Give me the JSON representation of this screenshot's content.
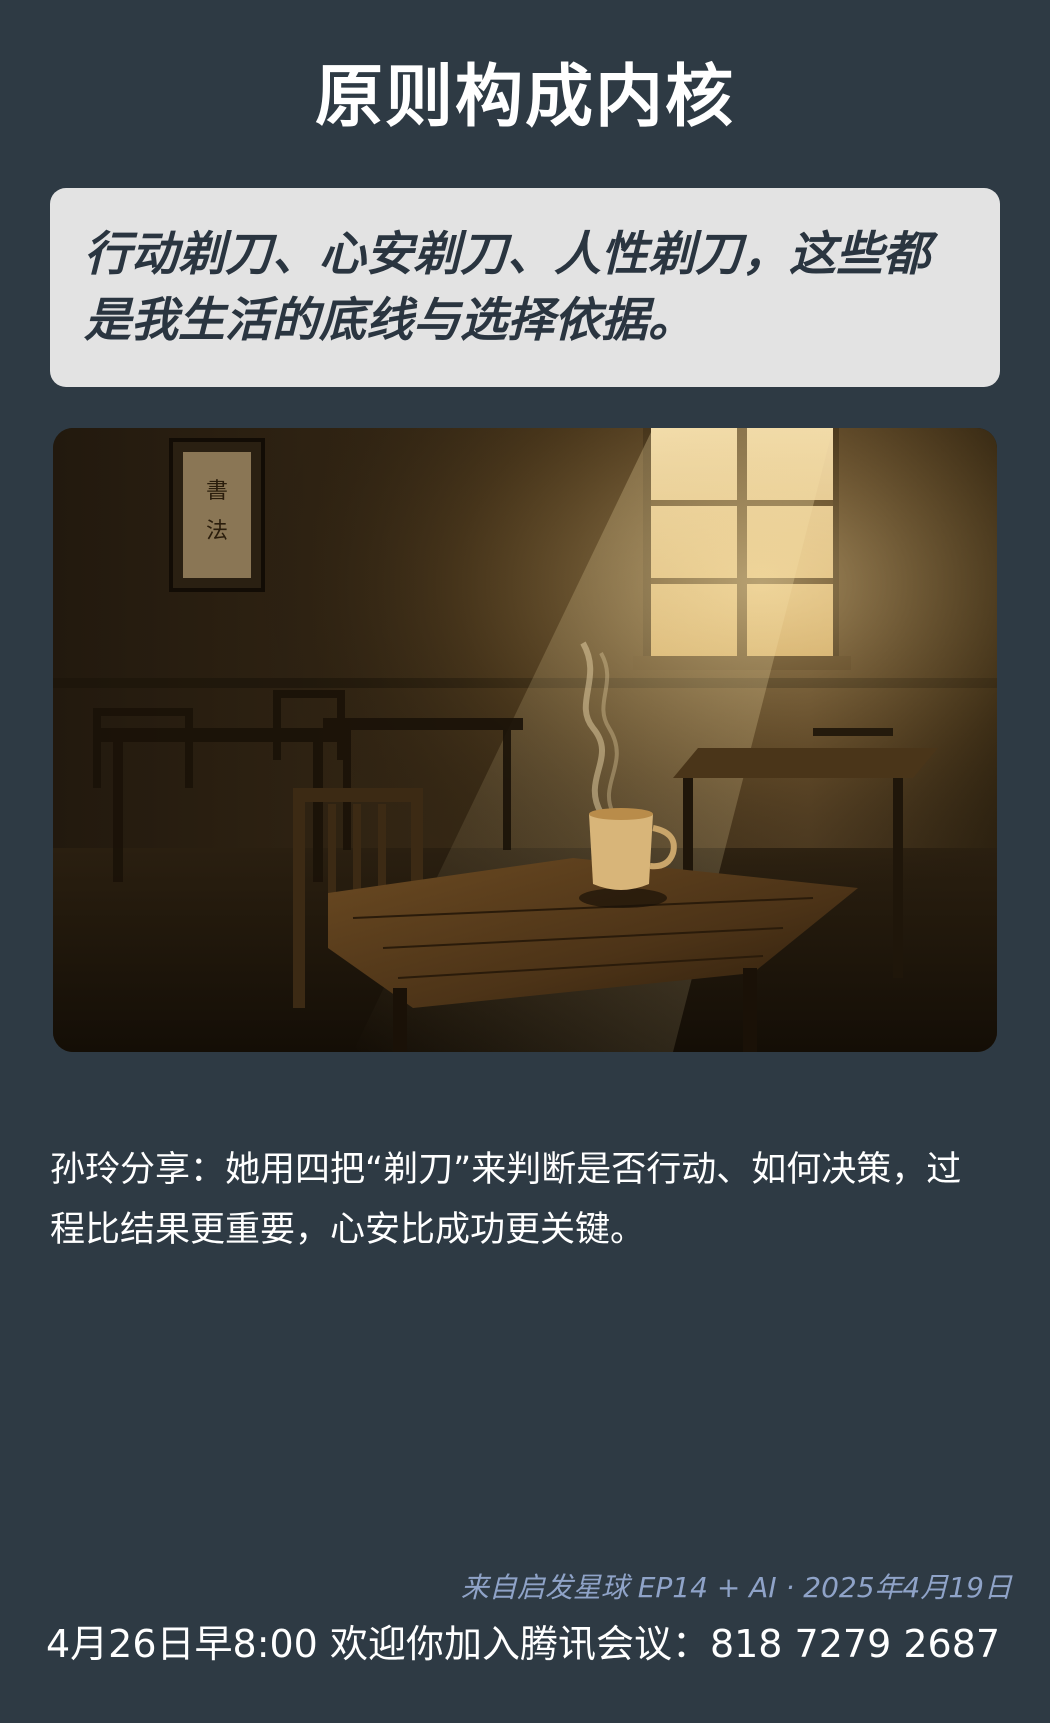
{
  "title": "原则构成内核",
  "quote": "行动剃刀、心安剃刀、人性剃刀，这些都是我生活的底线与选择依据。",
  "image": {
    "description_icon": "cafe-window-coffee-image",
    "calligraphy": "書法"
  },
  "caption": "孙玲分享：她用四把“剃刀”来判断是否行动、如何决策，过程比结果更重要，心安比成功更关键。",
  "source": "来自启发星球 EP14 + AI · 2025年4月19日",
  "footer": "4月26日早8:00 欢迎你加入腾讯会议：818 7279 2687",
  "colors": {
    "background": "#2e3a44",
    "quote_box": "#e3e3e3",
    "quote_text": "#2a3540",
    "source_text": "#8fa3c8"
  }
}
